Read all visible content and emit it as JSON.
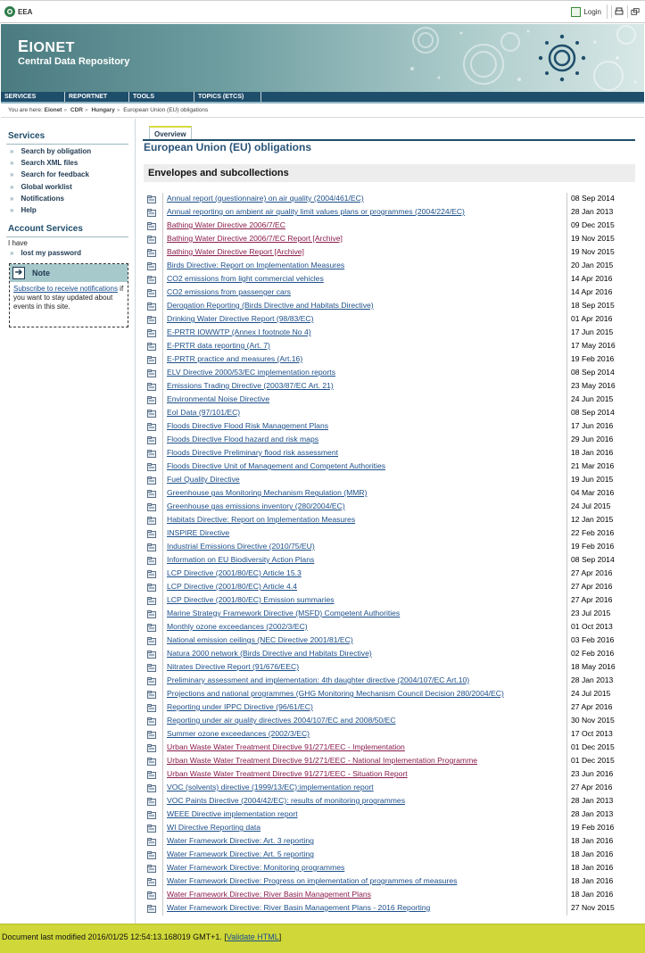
{
  "topbar": {
    "logo_text": "EEA",
    "login_label": "Login"
  },
  "banner": {
    "title_first_letter": "E",
    "title_rest": "IONET",
    "subtitle": "Central Data Repository"
  },
  "menu": {
    "items": [
      "SERVICES",
      "REPORTNET",
      "TOOLS",
      "TOPICS (ETCS)"
    ]
  },
  "breadcrumb": {
    "prefix": "You are here:",
    "items": [
      "Eionet",
      "CDR",
      "Hungary"
    ],
    "current": "European Union (EU) obligations"
  },
  "sidebar": {
    "services_heading": "Services",
    "services": [
      "Search by obligation",
      "Search XML files",
      "Search for feedback",
      "Global worklist",
      "Notifications",
      "Help"
    ],
    "account_heading": "Account Services",
    "i_have": "I have",
    "lost_password": "lost my password",
    "note": {
      "title": "Note",
      "link_text": "Subscribe to receive notifications",
      "text": " if you want to stay updated about events in this site."
    }
  },
  "main": {
    "tab_label": "Overview",
    "title": "European Union (EU) obligations",
    "section_title": "Envelopes and subcollections",
    "rows": [
      {
        "label": "Annual report (questionnaire) on air quality (2004/461/EC)",
        "date": "08 Sep 2014",
        "visited": false
      },
      {
        "label": "Annual reporting on ambient air quality limit values plans or programmes (2004/224/EC)",
        "date": "28 Jan 2013",
        "visited": false
      },
      {
        "label": "Bathing Water Directive 2006/7/EC",
        "date": "09 Dec 2015",
        "visited": true
      },
      {
        "label": "Bathing Water Directive 2006/7/EC Report [Archive]",
        "date": "19 Nov 2015",
        "visited": true
      },
      {
        "label": "Bathing Water Directive Report [Archive]",
        "date": "19 Nov 2015",
        "visited": true
      },
      {
        "label": "Birds Directive: Report on Implementation Measures",
        "date": "20 Jan 2015",
        "visited": false
      },
      {
        "label": "CO2 emissions from light commercial vehicles",
        "date": "14 Apr 2016",
        "visited": false
      },
      {
        "label": "CO2 emissions from passenger cars",
        "date": "14 Apr 2016",
        "visited": false
      },
      {
        "label": "Derogation Reporting (Birds Directive and Habitats Directive)",
        "date": "18 Sep 2015",
        "visited": false
      },
      {
        "label": "Drinking Water Directive Report (98/83/EC)",
        "date": "01 Apr 2016",
        "visited": false
      },
      {
        "label": "E-PRTR IOWWTP (Annex I footnote No 4)",
        "date": "17 Jun 2015",
        "visited": false
      },
      {
        "label": "E-PRTR data reporting (Art. 7)",
        "date": "17 May 2016",
        "visited": false
      },
      {
        "label": "E-PRTR practice and measures (Art.16)",
        "date": "19 Feb 2016",
        "visited": false
      },
      {
        "label": "ELV Directive 2000/53/EC implementation reports",
        "date": "08 Sep 2014",
        "visited": false
      },
      {
        "label": "Emissions Trading Directive (2003/87/EC Art. 21)",
        "date": "23 May 2016",
        "visited": false
      },
      {
        "label": "Environmental Noise Directive",
        "date": "24 Jun 2015",
        "visited": false
      },
      {
        "label": "EoI Data (97/101/EC)",
        "date": "08 Sep 2014",
        "visited": false
      },
      {
        "label": "Floods Directive Flood Risk Management Plans",
        "date": "17 Jun 2016",
        "visited": false
      },
      {
        "label": "Floods Directive Flood hazard and risk maps",
        "date": "29 Jun 2016",
        "visited": false
      },
      {
        "label": "Floods Directive Preliminary flood risk assessment",
        "date": "18 Jan 2016",
        "visited": false
      },
      {
        "label": "Floods Directive Unit of Management and Competent Authorities",
        "date": "21 Mar 2016",
        "visited": false
      },
      {
        "label": "Fuel Quality Directive",
        "date": "19 Jun 2015",
        "visited": false
      },
      {
        "label": "Greenhouse gas Monitoring Mechanism Regulation (MMR)",
        "date": "04 Mar 2016",
        "visited": false
      },
      {
        "label": "Greenhouse gas emissions inventory (280/2004/EC)",
        "date": "24 Jul 2015",
        "visited": false
      },
      {
        "label": "Habitats Directive: Report on Implementation Measures",
        "date": "12 Jan 2015",
        "visited": false
      },
      {
        "label": "INSPIRE Directive",
        "date": "22 Feb 2016",
        "visited": false
      },
      {
        "label": "Industrial Emissions Directive (2010/75/EU)",
        "date": "19 Feb 2016",
        "visited": false
      },
      {
        "label": "Information on EU Biodiversity Action Plans",
        "date": "08 Sep 2014",
        "visited": false
      },
      {
        "label": "LCP Directive (2001/80/EC) Article 15.3",
        "date": "27 Apr 2016",
        "visited": false
      },
      {
        "label": "LCP Directive (2001/80/EC) Article 4.4",
        "date": "27 Apr 2016",
        "visited": false
      },
      {
        "label": "LCP Directive (2001/80/EC) Emission summaries",
        "date": "27 Apr 2016",
        "visited": false
      },
      {
        "label": "Marine Strategy Framework Directive (MSFD) Competent Authorities",
        "date": "23 Jul 2015",
        "visited": false
      },
      {
        "label": "Monthly ozone exceedances (2002/3/EC)",
        "date": "01 Oct 2013",
        "visited": false
      },
      {
        "label": "National emission ceilings (NEC Directive 2001/81/EC)",
        "date": "03 Feb 2016",
        "visited": false
      },
      {
        "label": "Natura 2000 network (Birds Directive and Habitats Directive)",
        "date": "02 Feb 2016",
        "visited": false
      },
      {
        "label": "Nitrates Directive Report (91/676/EEC)",
        "date": "18 May 2016",
        "visited": false
      },
      {
        "label": "Preliminary assessment and implementation: 4th daughter directive (2004/107/EC Art.10)",
        "date": "28 Jan 2013",
        "visited": false
      },
      {
        "label": "Projections and national programmes (GHG Monitoring Mechanism Council Decision 280/2004/EC)",
        "date": "24 Jul 2015",
        "visited": false
      },
      {
        "label": "Reporting under IPPC Directive (96/61/EC)",
        "date": "27 Apr 2016",
        "visited": false
      },
      {
        "label": "Reporting under air quality directives 2004/107/EC and 2008/50/EC",
        "date": "30 Nov 2015",
        "visited": false
      },
      {
        "label": "Summer ozone exceedances (2002/3/EC)",
        "date": "17 Oct 2013",
        "visited": false
      },
      {
        "label": "Urban Waste Water Treatment Directive 91/271/EEC - Implementation",
        "date": "01 Dec 2015",
        "visited": true
      },
      {
        "label": "Urban Waste Water Treatment Directive 91/271/EEC - National Implementation Programme",
        "date": "01 Dec 2015",
        "visited": true
      },
      {
        "label": "Urban Waste Water Treatment Directive 91/271/EEC - Situation Report",
        "date": "23 Jun 2016",
        "visited": true
      },
      {
        "label": "VOC (solvents) directive (1999/13/EC):implementation report",
        "date": "27 Apr 2016",
        "visited": false
      },
      {
        "label": "VOC Paints Directive (2004/42/EC): results of monitoring programmes",
        "date": "28 Jan 2013",
        "visited": false
      },
      {
        "label": "WEEE Directive implementation report",
        "date": "28 Jan 2013",
        "visited": false
      },
      {
        "label": "WI Directive Reporting data",
        "date": "19 Feb 2016",
        "visited": false
      },
      {
        "label": "Water Framework Directive: Art. 3 reporting",
        "date": "18 Jan 2016",
        "visited": false
      },
      {
        "label": "Water Framework Directive: Art. 5 reporting",
        "date": "18 Jan 2016",
        "visited": false
      },
      {
        "label": "Water Framework Directive: Monitoring programmes",
        "date": "18 Jan 2016",
        "visited": false
      },
      {
        "label": "Water Framework Directive: Progress on implementation of programmes of measures",
        "date": "18 Jan 2016",
        "visited": false
      },
      {
        "label": "Water Framework Directive: River Basin Management Plans",
        "date": "18 Jan 2016",
        "visited": true
      },
      {
        "label": "Water Framework Directive: River Basin Management Plans - 2016 Reporting",
        "date": "27 Nov 2015",
        "visited": false
      }
    ]
  },
  "footer": {
    "text": "Document last modified 2016/01/25 12:54:13.168019 GMT+1. [",
    "link": "Validate HTML",
    "tail": "]"
  },
  "colors": {
    "link": "#1c4f8a",
    "visited_link": "#8a1c4a",
    "menubar": "#1f4e6b",
    "footer": "#cfd838"
  }
}
